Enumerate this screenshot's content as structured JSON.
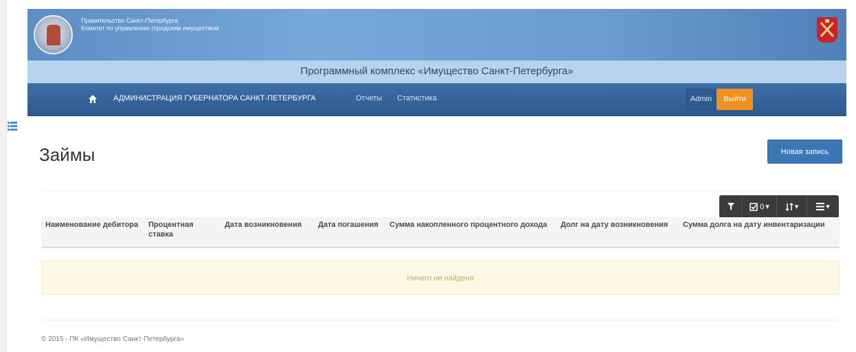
{
  "header": {
    "org_line1": "Правительство Санкт-Петербурга",
    "org_line2": "Комитет по управлению городским имуществом",
    "app_title": "Программный комплекс «Имущество Санкт-Петербурга»"
  },
  "navbar": {
    "home_icon": "home-icon",
    "items": [
      {
        "label": "АДМИНИСТРАЦИЯ ГУБЕРНАТОРА САНКТ-ПЕТЕРБУРГА"
      },
      {
        "label": "Отчеты"
      },
      {
        "label": "Статистика"
      }
    ],
    "user_label": "Admin",
    "logout_label": "Выйти"
  },
  "page": {
    "title": "Займы",
    "new_record_label": "Новая запись"
  },
  "toolbar": {
    "filter_icon": "filter-icon",
    "checked_count": "0",
    "sort_icon": "sort-icon",
    "columns_icon": "columns-icon"
  },
  "table": {
    "columns": [
      "Наименование дебитора",
      "Процентная ставка",
      "Дата возникновения",
      "Дата погашения",
      "Сумма накопленного процентного дохода",
      "Долг на дату возникновения",
      "Сумма долга на дату инвентаризации"
    ],
    "empty_message": "Ничего не найдено"
  },
  "footer": {
    "text": "© 2015 - ПК «Имущество Санкт-Петербурга»"
  },
  "colors": {
    "navbar": "#2e5a8e",
    "accent_orange": "#f0901f",
    "primary_button": "#3b77b7",
    "empty_row": "#fcf8e3"
  }
}
